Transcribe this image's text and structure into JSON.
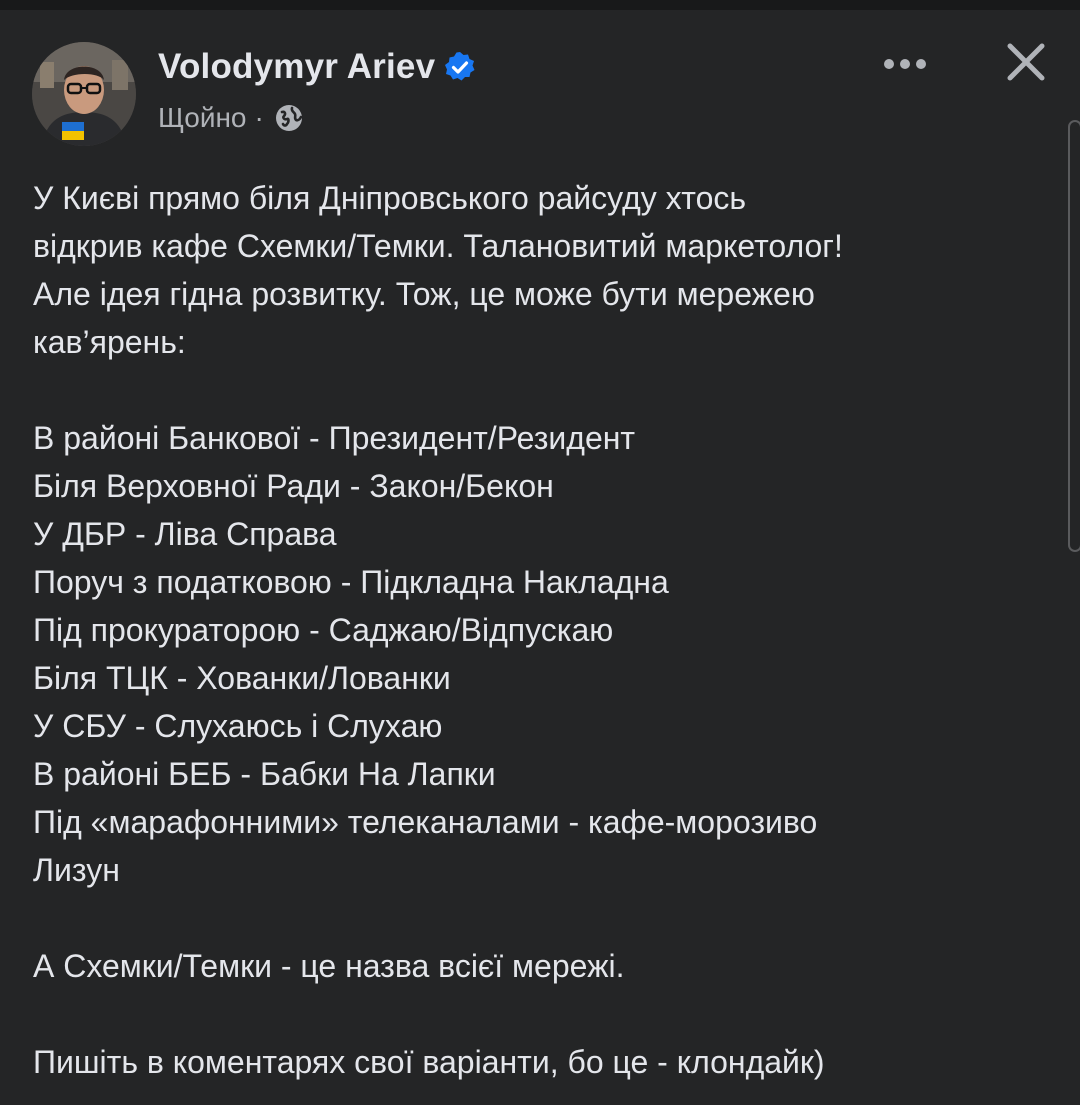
{
  "post": {
    "author": "Volodymyr Ariev",
    "time": "Щойно",
    "separator": "·",
    "paragraphs": [
      [
        "У Києві прямо біля Дніпровського райсуду хтось",
        "відкрив кафе Схемки/Темки. Талановитий маркетолог!",
        "Але ідея гідна розвитку. Тож, це може бути мережею",
        "кав’ярень:"
      ],
      [
        "В районі Банкової - Президент/Резидент",
        "Біля Верховної Ради - Закон/Бекон",
        "У ДБР - Ліва Справа",
        "Поруч з податковою - Підкладна Накладна",
        "Під прокураторою - Саджаю/Відпускаю",
        "Біля ТЦК - Хованки/Лованки",
        "У СБУ - Слухаюсь і Слухаю",
        "В районі БЕБ - Бабки На Лапки",
        "Під «марафонними» телеканалами - кафе-морозиво",
        "Лизун"
      ],
      [
        "А Схемки/Темки - це назва всієї мережі."
      ],
      [
        "Пишіть в коментарях свої варіанти, бо це - клондайк)"
      ]
    ]
  },
  "icons": {
    "verified": "verified-badge-icon",
    "privacy": "globe-icon",
    "more": "more-options-icon",
    "close": "close-icon"
  },
  "colors": {
    "background": "#242526",
    "text": "#e4e6eb",
    "secondary_text": "#b0b3b8",
    "verified_blue": "#1877f2"
  }
}
